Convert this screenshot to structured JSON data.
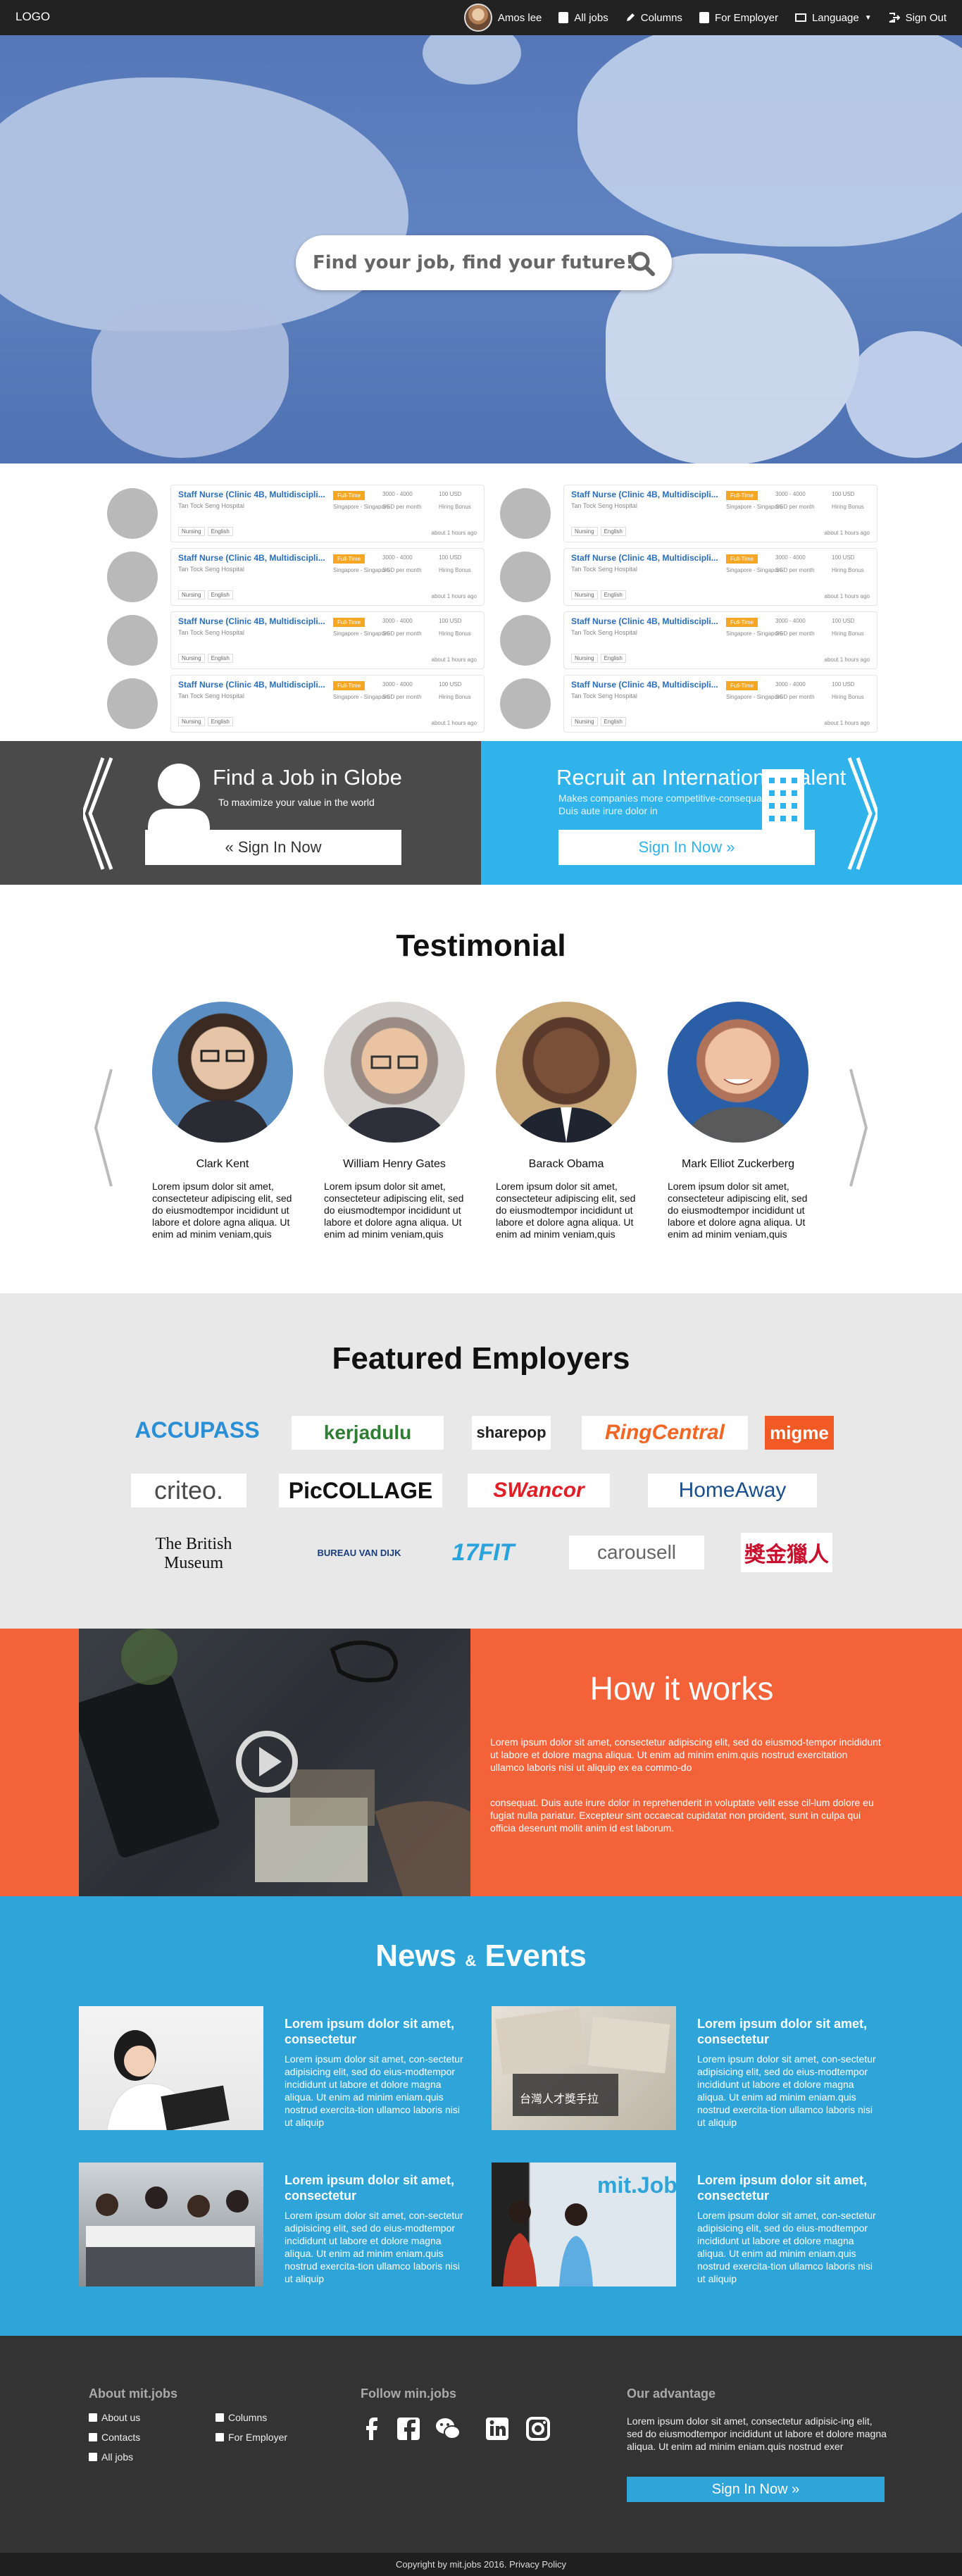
{
  "nav": {
    "logo": "LOGO",
    "user_name": "Amos lee",
    "all_jobs": "All jobs",
    "columns": "Columns",
    "for_employer": "For Employer",
    "language": "Language",
    "sign_out": "Sign Out"
  },
  "hero": {
    "search_placeholder": "Find your job, find your future!"
  },
  "jobs": {
    "title": "Staff Nurse (Clinic 4B, Multidiscipli...",
    "hospital": "Tan Tock Seng Hospital",
    "type": "Full-Time",
    "location": "Singapore - Singapore",
    "salary": "3000 - 4000",
    "period": "SGD per month",
    "currency": "100 USD",
    "hiring": "Hiring Bonus",
    "tag1": "Nursing",
    "tag2": "English",
    "time": "about 1 hours ago"
  },
  "cta": {
    "left_title": "Find a Job in Globe",
    "left_sub": "To maximize your value in the world",
    "left_button": "Sign In Now",
    "right_title": "Recruit an International Talent",
    "right_sub": "Makes companies more competitive-consequat. Duis aute irure dolor in",
    "right_button": "Sign In Now"
  },
  "testimonial": {
    "title": "Testimonial",
    "items": [
      {
        "name": "Clark Kent",
        "text": "Lorem ipsum dolor sit amet, consecteteur adipiscing elit, sed do eiusmodtempor incididunt ut labore et dolore agna aliqua. Ut enim ad minim veniam,quis"
      },
      {
        "name": "William Henry Gates",
        "text": "Lorem ipsum dolor sit amet, consecteteur adipiscing elit, sed do eiusmodtempor incididunt ut labore et dolore agna aliqua. Ut enim ad minim veniam,quis"
      },
      {
        "name": "Barack Obama",
        "text": "Lorem ipsum dolor sit amet, consecteteur adipiscing elit, sed do eiusmodtempor incididunt ut labore et dolore agna aliqua. Ut enim ad minim veniam,quis"
      },
      {
        "name": "Mark Elliot Zuckerberg",
        "text": "Lorem ipsum dolor sit amet, consecteteur adipiscing elit, sed do eiusmodtempor incididunt ut labore et dolore agna aliqua. Ut enim ad minim veniam,quis"
      }
    ]
  },
  "employers": {
    "title": "Featured Employers",
    "logos": [
      "ACCUPASS",
      "kerjadulu",
      "sharepop",
      "RingCentral",
      "migme",
      "criteo.",
      "PicCOLLAGE",
      "SWancor",
      "HomeAway",
      "The British Museum",
      "BUREAU VAN DIJK",
      "17FIT",
      "carousell",
      "獎金獵人"
    ]
  },
  "how": {
    "title": "How it works",
    "p1": "Lorem ipsum dolor sit amet, consectetur adipiscing elit, sed do eiusmod-tempor incididunt ut labore et dolore magna aliqua. Ut enim ad minim enim.quis nostrud exercitation ullamco laboris nisi ut aliquip ex ea commo-do",
    "p2": "consequat. Duis aute irure dolor in reprehenderit in voluptate velit esse cil-lum dolore eu fugiat nulla pariatur. Excepteur sint occaecat cupidatat non proident, sunt in culpa qui officia deserunt mollit anim id est laborum."
  },
  "news": {
    "title_a": "News",
    "title_amp": "&",
    "title_b": "Events",
    "items": [
      {
        "title": "Lorem ipsum dolor sit amet, consectetur",
        "text": "Lorem ipsum dolor sit amet, con-sectetur adipisicing elit, sed do eius-modtempor incididunt ut labore et dolore magna aliqua. Ut enim ad minim eniam.quis nostrud exercita-tion ullamco laboris nisi ut aliquip"
      },
      {
        "title": "Lorem ipsum dolor sit amet, consectetur",
        "text": "Lorem ipsum dolor sit amet, con-sectetur adipisicing elit, sed do eius-modtempor incididunt ut labore et dolore magna aliqua. Ut enim ad minim eniam.quis nostrud exercita-tion ullamco laboris nisi ut aliquip"
      },
      {
        "title": "Lorem ipsum dolor sit amet, consectetur",
        "text": "Lorem ipsum dolor sit amet, con-sectetur adipisicing elit, sed do eius-modtempor incididunt ut labore et dolore magna aliqua. Ut enim ad minim eniam.quis nostrud exercita-tion ullamco laboris nisi ut aliquip"
      },
      {
        "title": "Lorem ipsum dolor sit amet, consectetur",
        "text": "Lorem ipsum dolor sit amet, con-sectetur adipisicing elit, sed do eius-modtempor incididunt ut labore et dolore magna aliqua. Ut enim ad minim eniam.quis nostrud exercita-tion ullamco laboris nisi ut aliquip"
      }
    ],
    "img_caption_chinese": "台灣人才獎手拉",
    "img_caption_mitjobs": "mit.Jobs"
  },
  "footer": {
    "about_title": "About mit.jobs",
    "about_us": "About us",
    "columns": "Columns",
    "contacts": "Contacts",
    "for_employer": "For Employer",
    "all_jobs": "All jobs",
    "follow_title": "Follow min.jobs",
    "advantage_title": "Our advantage",
    "advantage_text": "Lorem ipsum dolor sit amet, consectetur adipisic-ing elit, sed do eiusmodtempor incididunt ut labore et dolore magna aliqua. Ut enim ad minim eniam.quis nostrud exer",
    "button": "Sign In Now",
    "copyright": "Copyright by mit.jobs 2016.  Privacy Policy"
  },
  "colors": {
    "nav": "#222222",
    "accent_blue": "#2fb3ea",
    "orange": "#f4623a",
    "news_blue": "#2fa4d9"
  }
}
